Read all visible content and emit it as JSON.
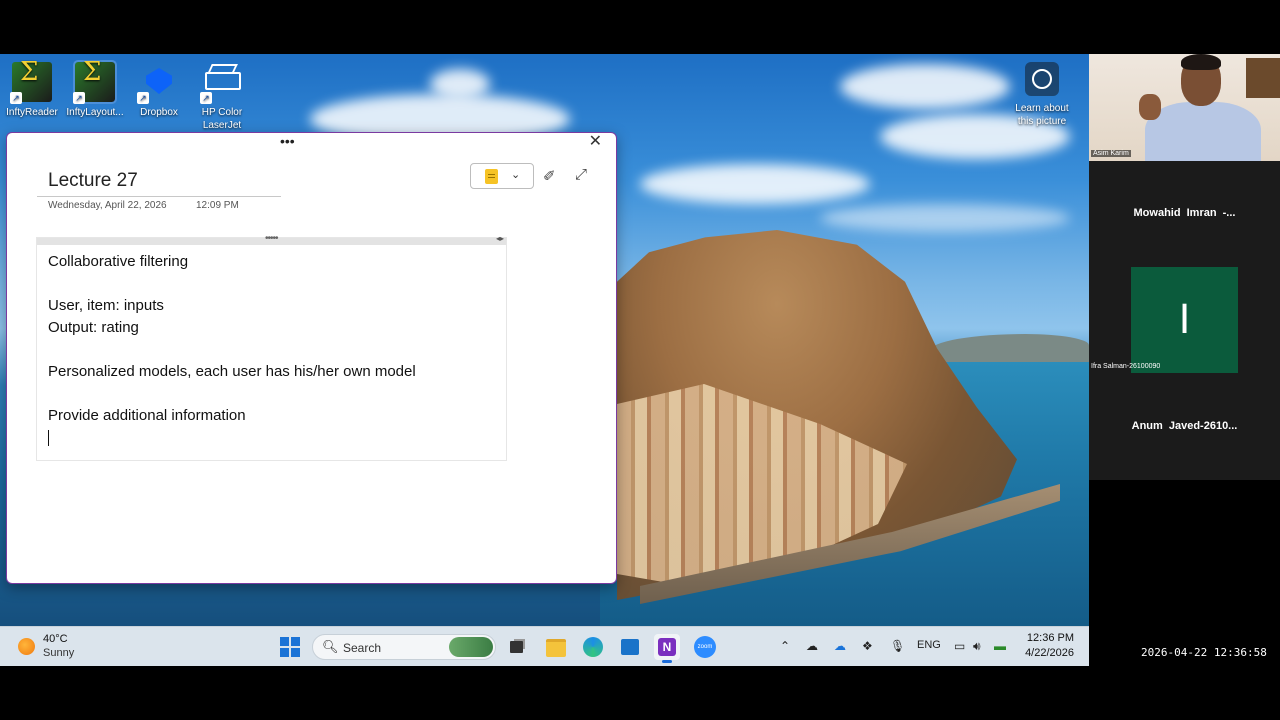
{
  "desktop": {
    "icons": [
      {
        "label": "InftyReader"
      },
      {
        "label": "InftyLayout..."
      },
      {
        "label": "Dropbox"
      },
      {
        "label": "HP Color LaserJet Pro..."
      }
    ],
    "learn_about": "Learn about this picture"
  },
  "note_window": {
    "title": "Lecture 27",
    "date": "Wednesday, April 22, 2026",
    "time": "12:09 PM",
    "lines": [
      "Collaborative filtering",
      "User, item: inputs",
      "Output: rating",
      "Personalized models, each user has his/her own model",
      "Provide additional information"
    ]
  },
  "taskbar": {
    "weather_temp": "40°C",
    "weather_condition": "Sunny",
    "search_label": "Search",
    "language": "ENG",
    "clock_time": "12:36 PM",
    "clock_date": "4/22/2026"
  },
  "video_panel": {
    "host_name": "Asim Karim",
    "participants": [
      {
        "name": "Mowahid  Imran  -..."
      },
      {
        "name": "Anum  Javed-2610..."
      }
    ],
    "tile_initial": "I",
    "tile_label": "Ifra Salman-26100090"
  },
  "timestamp": "2026-04-22  12:36:58",
  "colors": {
    "onenote_border": "#7a3aa0",
    "participant_tile": "#0b5b3c",
    "taskbar": "#dbe4ec"
  }
}
